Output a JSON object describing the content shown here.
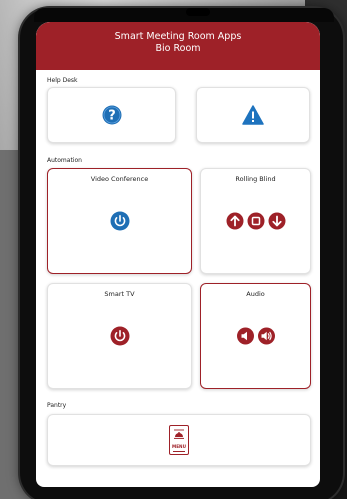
{
  "header": {
    "title": "Smart Meeting Room Apps",
    "subtitle": "Bio Room"
  },
  "sections": {
    "help_desk": "Help Desk",
    "automation": "Automation",
    "pantry": "Pantry"
  },
  "tiles": {
    "help": {
      "icon": "help-icon"
    },
    "warning": {
      "icon": "warning-icon"
    },
    "video_conference": {
      "label": "Video Conference",
      "icon": "power-icon"
    },
    "rolling_blind": {
      "label": "Rolling Blind",
      "icons": [
        "arrow-up-icon",
        "stop-icon",
        "arrow-down-icon"
      ]
    },
    "smart_tv": {
      "label": "Smart TV",
      "icon": "power-icon"
    },
    "audio": {
      "label": "Audio",
      "icons": [
        "volume-down-icon",
        "volume-up-icon"
      ]
    },
    "menu": {
      "label": "MENU",
      "icon": "menu-book-icon"
    }
  },
  "colors": {
    "brand": "#9e2128",
    "blue": "#1f6fb5",
    "warning_blue": "#1e73be"
  }
}
